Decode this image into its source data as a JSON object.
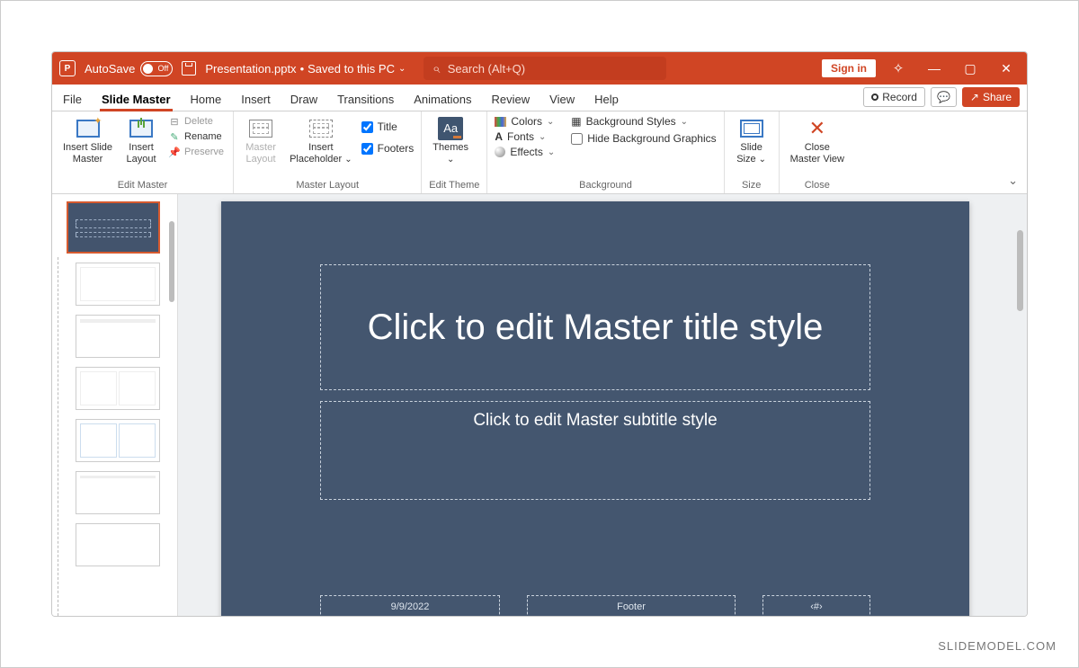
{
  "titlebar": {
    "autosave_label": "AutoSave",
    "autosave_state": "Off",
    "filename": "Presentation.pptx",
    "save_status": "Saved to this PC",
    "search_placeholder": "Search (Alt+Q)",
    "signin": "Sign in"
  },
  "tabs": {
    "items": [
      "File",
      "Slide Master",
      "Home",
      "Insert",
      "Draw",
      "Transitions",
      "Animations",
      "Review",
      "View",
      "Help"
    ],
    "active_index": 1,
    "record": "Record",
    "share": "Share"
  },
  "ribbon": {
    "edit_master": {
      "insert_slide_master": "Insert Slide\nMaster",
      "insert_layout": "Insert\nLayout",
      "delete": "Delete",
      "rename": "Rename",
      "preserve": "Preserve",
      "group": "Edit Master"
    },
    "master_layout": {
      "master_layout": "Master\nLayout",
      "insert_placeholder": "Insert\nPlaceholder",
      "title_chk": "Title",
      "footers_chk": "Footers",
      "group": "Master Layout"
    },
    "edit_theme": {
      "themes": "Themes",
      "group": "Edit Theme"
    },
    "background": {
      "colors": "Colors",
      "fonts": "Fonts",
      "effects": "Effects",
      "bg_styles": "Background Styles",
      "hide_bg": "Hide Background Graphics",
      "group": "Background"
    },
    "size": {
      "slide_size": "Slide\nSize",
      "group": "Size"
    },
    "close": {
      "close_master": "Close\nMaster View",
      "group": "Close"
    }
  },
  "slide": {
    "title_placeholder": "Click to edit Master title style",
    "subtitle_placeholder": "Click to edit Master subtitle style",
    "date": "9/9/2022",
    "footer": "Footer",
    "number": "‹#›"
  },
  "watermark": "SLIDEMODEL.COM"
}
